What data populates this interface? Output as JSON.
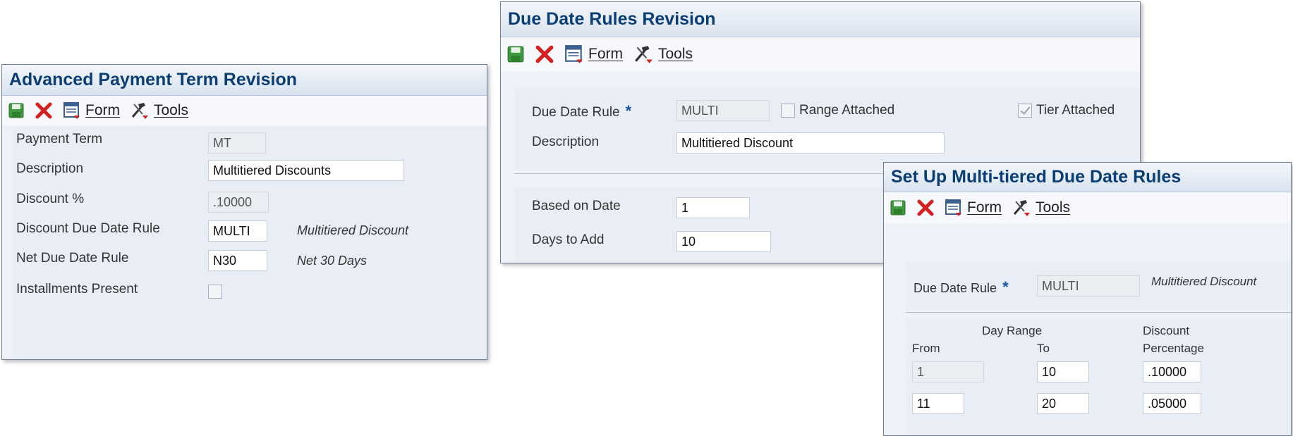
{
  "toolbar_labels": {
    "form": "Form",
    "tools": "Tools"
  },
  "apt": {
    "title": "Advanced Payment Term Revision",
    "payment_term_label": "Payment Term",
    "payment_term_value": "MT",
    "description_label": "Description",
    "description_value": "Multitiered Discounts",
    "discount_pct_label": "Discount %",
    "discount_pct_value": ".10000",
    "discount_rule_label": "Discount Due Date Rule",
    "discount_rule_value": "MULTI",
    "discount_rule_desc": "Multitiered Discount",
    "net_rule_label": "Net Due Date Rule",
    "net_rule_value": "N30",
    "net_rule_desc": "Net 30 Days",
    "installments_label": "Installments Present",
    "installments_checked": false
  },
  "ddr": {
    "title": "Due Date Rules Revision",
    "rule_label": "Due Date Rule",
    "required_mark": "*",
    "rule_value": "MULTI",
    "range_attached_label": "Range Attached",
    "range_attached_checked": false,
    "tier_attached_label": "Tier Attached",
    "tier_attached_checked": true,
    "description_label": "Description",
    "description_value": "Multitiered Discount",
    "based_on_label": "Based on Date",
    "based_on_value": "1",
    "days_to_add_label": "Days to Add",
    "days_to_add_value": "10"
  },
  "mt": {
    "title": "Set Up Multi-tiered Due Date Rules",
    "rule_label": "Due Date Rule",
    "required_mark": "*",
    "rule_value": "MULTI",
    "rule_desc": "Multitiered Discount",
    "day_range_header": "Day Range",
    "from_header": "From",
    "to_header": "To",
    "discount_header_1": "Discount",
    "discount_header_2": "Percentage",
    "rows": [
      {
        "from": "1",
        "to": "10",
        "pct": ".10000"
      },
      {
        "from": "11",
        "to": "20",
        "pct": ".05000"
      }
    ]
  }
}
